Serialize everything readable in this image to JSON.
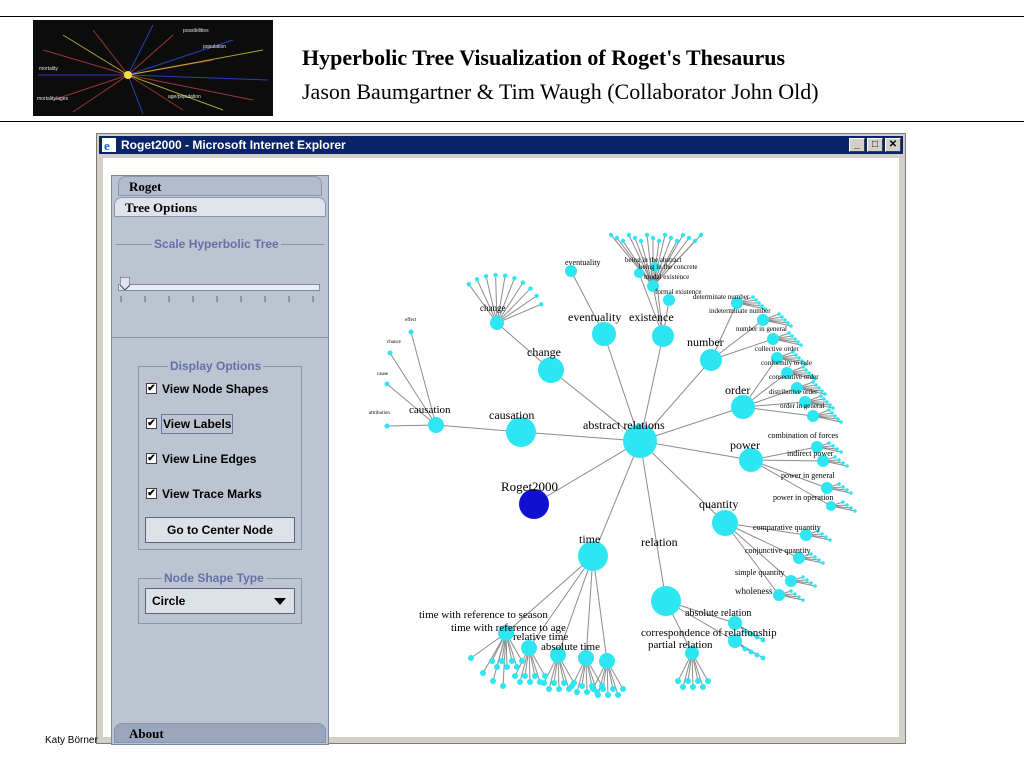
{
  "slide": {
    "title": "Hyperbolic Tree Visualization of  Roget's Thesaurus",
    "subtitle": "Jason Baumgartner & Tim Waugh (Collaborator John Old)",
    "footer": "Katy Börner"
  },
  "window": {
    "title": "Roget2000 - Microsoft Internet Explorer",
    "minimize_glyph": "_",
    "maximize_glyph": "□",
    "close_glyph": "✕"
  },
  "panel": {
    "tabs": [
      "Roget",
      "Tree Options",
      "About"
    ],
    "scale_group_title": "Scale Hyperbolic Tree",
    "scale_level": 0.02,
    "display_group_title": "Display Options",
    "checkboxes": [
      {
        "label": "View Node Shapes",
        "checked": true
      },
      {
        "label": "View Labels",
        "checked": true
      },
      {
        "label": "View Line Edges",
        "checked": true
      },
      {
        "label": "View Trace Marks",
        "checked": true
      }
    ],
    "check_glyph": "✔",
    "center_button": "Go to Center Node",
    "shape_group_title": "Node Shape Type",
    "shape_select": "Circle"
  },
  "tree": {
    "colors": {
      "node": "#2ee6f2",
      "edge": "#8c8c8c",
      "root": "#1010d0"
    },
    "labels": {
      "center": "abstract relations",
      "root": "Roget2000",
      "causation": "causation",
      "causation_sub": "causation",
      "change": "change",
      "change_sub": "change",
      "eventuality": "eventuality",
      "eventuality_sub": "eventuality",
      "existence": "existence",
      "number": "number",
      "order": "order",
      "power": "power",
      "quantity": "quantity",
      "time": "time",
      "relation": "relation",
      "time_season": "time with reference to season",
      "time_age": "time with reference to age",
      "correspondence": "correspondence of relationship",
      "absolute_relation": "absolute relation",
      "absolute_time": "absolute time",
      "relative_time": "relative time",
      "partial_relation": "partial relation",
      "comparative_quantity": "comparative quantity",
      "conjunctive_quantity": "conjunctive quantity",
      "simple_quantity": "simple quantity",
      "wholeness": "wholeness",
      "combination_of_forces": "combination of forces",
      "indirect_power": "indirect power",
      "power_in_general": "power in general",
      "power_in_operation": "power in operation",
      "collective_order": "collective order",
      "conformity": "conformity to rule",
      "consecutive_order": "consecutive order",
      "distributive_order": "distributive order",
      "order_in_general": "order in general",
      "indeterminate_number": "indeterminate number",
      "determinate_number": "determinate number",
      "number_in_general": "number in general",
      "formal_existence": "formal existence",
      "modal_existence": "modal existence",
      "being_abstract": "being in the abstract",
      "being_concrete": "being in the concrete",
      "effect": "effect",
      "chance": "chance",
      "cause": "cause",
      "attribution": "attribution"
    }
  }
}
